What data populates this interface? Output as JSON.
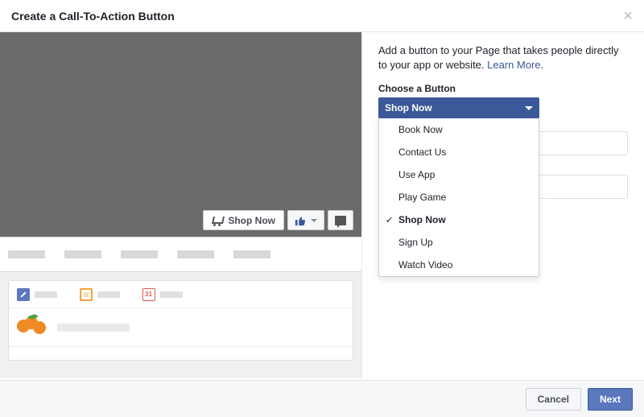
{
  "header": {
    "title": "Create a Call-To-Action Button"
  },
  "preview": {
    "cta_label": "Shop Now"
  },
  "form": {
    "description_text": "Add a button to your Page that takes people directly to your app or website. ",
    "learn_more": "Learn More",
    "period": ".",
    "choose_label": "Choose a Button",
    "dropdown": {
      "selected": "Shop Now",
      "options": [
        "Book Now",
        "Contact Us",
        "Use App",
        "Play Game",
        "Shop Now",
        "Sign Up",
        "Watch Video"
      ],
      "selected_index": 4
    }
  },
  "footer": {
    "cancel": "Cancel",
    "next": "Next"
  }
}
